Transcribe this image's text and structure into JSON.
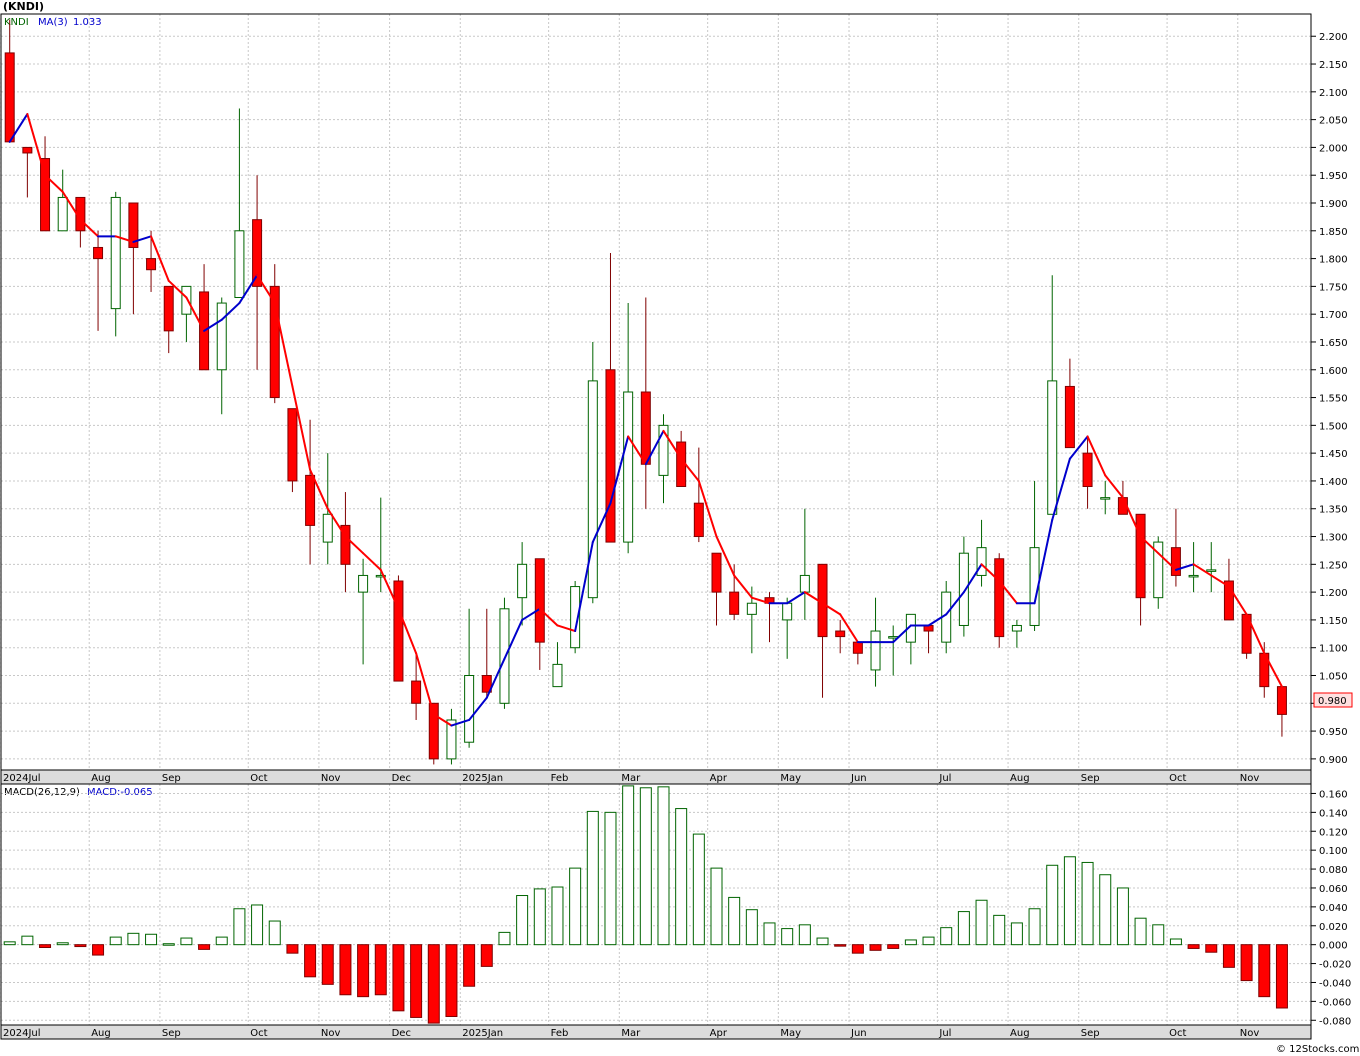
{
  "title": "(KNDI)",
  "price_legend": {
    "symbol": "KNDI",
    "ma_label": "MA(3)",
    "ma_value": "1.033"
  },
  "macd_legend": {
    "label": "MACD(26,12,9)",
    "value_label": "MACD:-0.065"
  },
  "last_price_label": "0.980",
  "watermark": "© 12Stocks.com",
  "colors": {
    "up": "#006400",
    "down": "#ff0000",
    "ma_up": "#0000cc",
    "ma_down": "#ff0000",
    "grid": "#c8c8c8",
    "axis_bar": "#dcdcdc"
  },
  "chart_data": [
    {
      "type": "candlestick",
      "title": "(KNDI)",
      "ylim": [
        0.88,
        2.24
      ],
      "yticks": [
        "2.200",
        "2.150",
        "2.100",
        "2.050",
        "2.000",
        "1.950",
        "1.900",
        "1.850",
        "1.800",
        "1.750",
        "1.700",
        "1.650",
        "1.600",
        "1.550",
        "1.500",
        "1.450",
        "1.400",
        "1.350",
        "1.300",
        "1.250",
        "1.200",
        "1.150",
        "1.100",
        "1.050",
        "1.000",
        "0.950",
        "0.900"
      ],
      "x_labels": [
        "2024Jul",
        "Aug",
        "Sep",
        "Oct",
        "Nov",
        "Dec",
        "2025Jan",
        "Feb",
        "Mar",
        "Apr",
        "May",
        "Jun",
        "Jul",
        "Aug",
        "Sep",
        "Oct",
        "Nov"
      ],
      "x_label_week": [
        0,
        5,
        9,
        14,
        18,
        22,
        26,
        31,
        35,
        40,
        44,
        48,
        53,
        57,
        61,
        66,
        70
      ],
      "ohlc": [
        [
          2.17,
          2.23,
          2.01,
          2.01
        ],
        [
          2.0,
          2.0,
          1.91,
          1.99
        ],
        [
          1.98,
          2.02,
          1.85,
          1.85
        ],
        [
          1.85,
          1.96,
          1.85,
          1.91
        ],
        [
          1.91,
          1.91,
          1.82,
          1.85
        ],
        [
          1.82,
          1.85,
          1.67,
          1.8
        ],
        [
          1.71,
          1.92,
          1.66,
          1.91
        ],
        [
          1.9,
          1.9,
          1.7,
          1.82
        ],
        [
          1.8,
          1.85,
          1.74,
          1.78
        ],
        [
          1.75,
          1.75,
          1.63,
          1.67
        ],
        [
          1.7,
          1.75,
          1.65,
          1.75
        ],
        [
          1.74,
          1.79,
          1.6,
          1.6
        ],
        [
          1.6,
          1.73,
          1.52,
          1.72
        ],
        [
          1.73,
          2.07,
          1.73,
          1.85
        ],
        [
          1.87,
          1.95,
          1.6,
          1.75
        ],
        [
          1.75,
          1.79,
          1.54,
          1.55
        ],
        [
          1.53,
          1.53,
          1.38,
          1.4
        ],
        [
          1.41,
          1.51,
          1.25,
          1.32
        ],
        [
          1.29,
          1.45,
          1.25,
          1.34
        ],
        [
          1.32,
          1.38,
          1.2,
          1.25
        ],
        [
          1.2,
          1.26,
          1.07,
          1.23
        ],
        [
          1.23,
          1.37,
          1.2,
          1.23
        ],
        [
          1.22,
          1.23,
          1.04,
          1.04
        ],
        [
          1.04,
          1.09,
          0.97,
          1.0
        ],
        [
          1.0,
          1.0,
          0.89,
          0.9
        ],
        [
          0.9,
          0.99,
          0.89,
          0.97
        ],
        [
          0.93,
          1.17,
          0.92,
          1.05
        ],
        [
          1.05,
          1.17,
          1.01,
          1.02
        ],
        [
          1.0,
          1.19,
          0.99,
          1.17
        ],
        [
          1.19,
          1.29,
          1.14,
          1.25
        ],
        [
          1.26,
          1.26,
          1.06,
          1.11
        ],
        [
          1.03,
          1.11,
          1.03,
          1.07
        ],
        [
          1.1,
          1.22,
          1.09,
          1.21
        ],
        [
          1.19,
          1.65,
          1.18,
          1.58
        ],
        [
          1.6,
          1.81,
          1.29,
          1.29
        ],
        [
          1.29,
          1.72,
          1.27,
          1.56
        ],
        [
          1.56,
          1.73,
          1.35,
          1.43
        ],
        [
          1.41,
          1.52,
          1.36,
          1.5
        ],
        [
          1.47,
          1.49,
          1.39,
          1.39
        ],
        [
          1.36,
          1.46,
          1.29,
          1.3
        ],
        [
          1.27,
          1.27,
          1.14,
          1.2
        ],
        [
          1.2,
          1.25,
          1.15,
          1.16
        ],
        [
          1.16,
          1.21,
          1.09,
          1.18
        ],
        [
          1.19,
          1.2,
          1.11,
          1.18
        ],
        [
          1.15,
          1.19,
          1.08,
          1.18
        ],
        [
          1.2,
          1.35,
          1.15,
          1.23
        ],
        [
          1.25,
          1.25,
          1.01,
          1.12
        ],
        [
          1.13,
          1.15,
          1.09,
          1.12
        ],
        [
          1.11,
          1.11,
          1.07,
          1.09
        ],
        [
          1.06,
          1.19,
          1.03,
          1.13
        ],
        [
          1.12,
          1.14,
          1.05,
          1.12
        ],
        [
          1.11,
          1.16,
          1.07,
          1.16
        ],
        [
          1.14,
          1.14,
          1.09,
          1.13
        ],
        [
          1.11,
          1.22,
          1.09,
          1.2
        ],
        [
          1.14,
          1.3,
          1.12,
          1.27
        ],
        [
          1.23,
          1.33,
          1.21,
          1.28
        ],
        [
          1.26,
          1.27,
          1.1,
          1.12
        ],
        [
          1.13,
          1.15,
          1.1,
          1.14
        ],
        [
          1.14,
          1.4,
          1.13,
          1.28
        ],
        [
          1.34,
          1.77,
          1.34,
          1.58
        ],
        [
          1.57,
          1.62,
          1.46,
          1.46
        ],
        [
          1.45,
          1.48,
          1.35,
          1.39
        ],
        [
          1.37,
          1.4,
          1.34,
          1.37
        ],
        [
          1.37,
          1.4,
          1.34,
          1.34
        ],
        [
          1.34,
          1.34,
          1.14,
          1.19
        ],
        [
          1.19,
          1.3,
          1.17,
          1.29
        ],
        [
          1.28,
          1.35,
          1.21,
          1.23
        ],
        [
          1.23,
          1.29,
          1.2,
          1.23
        ],
        [
          1.24,
          1.29,
          1.2,
          1.24
        ],
        [
          1.22,
          1.26,
          1.15,
          1.15
        ],
        [
          1.16,
          1.16,
          1.08,
          1.09
        ],
        [
          1.09,
          1.11,
          1.01,
          1.03
        ],
        [
          1.03,
          1.03,
          0.94,
          0.98
        ]
      ],
      "ma3": [
        2.01,
        2.06,
        1.95,
        1.92,
        1.87,
        1.84,
        1.84,
        1.83,
        1.84,
        1.76,
        1.73,
        1.67,
        1.69,
        1.72,
        1.77,
        1.72,
        1.57,
        1.42,
        1.35,
        1.3,
        1.27,
        1.24,
        1.17,
        1.09,
        0.98,
        0.96,
        0.97,
        1.01,
        1.08,
        1.15,
        1.17,
        1.14,
        1.13,
        1.29,
        1.36,
        1.48,
        1.43,
        1.49,
        1.44,
        1.4,
        1.3,
        1.23,
        1.19,
        1.18,
        1.18,
        1.2,
        1.18,
        1.16,
        1.11,
        1.11,
        1.11,
        1.14,
        1.14,
        1.16,
        1.2,
        1.25,
        1.22,
        1.18,
        1.18,
        1.33,
        1.44,
        1.48,
        1.41,
        1.37,
        1.3,
        1.27,
        1.24,
        1.25,
        1.23,
        1.21,
        1.16,
        1.09,
        1.03
      ]
    },
    {
      "type": "bar",
      "title": "MACD(26,12,9)",
      "ylim": [
        -0.085,
        0.17
      ],
      "yticks": [
        "0.160",
        "0.140",
        "0.120",
        "0.100",
        "0.080",
        "0.060",
        "0.040",
        "0.020",
        "0.000",
        "-0.020",
        "-0.040",
        "-0.060",
        "-0.080"
      ],
      "values": [
        0.003,
        0.009,
        -0.003,
        0.002,
        -0.002,
        -0.011,
        0.008,
        0.012,
        0.011,
        0.001,
        0.007,
        -0.005,
        0.008,
        0.038,
        0.042,
        0.025,
        -0.009,
        -0.034,
        -0.042,
        -0.053,
        -0.055,
        -0.053,
        -0.07,
        -0.077,
        -0.083,
        -0.076,
        -0.044,
        -0.023,
        0.013,
        0.052,
        0.059,
        0.061,
        0.081,
        0.141,
        0.14,
        0.168,
        0.166,
        0.167,
        0.144,
        0.117,
        0.081,
        0.05,
        0.037,
        0.023,
        0.017,
        0.021,
        0.007,
        -0.001,
        -0.009,
        -0.006,
        -0.004,
        0.005,
        0.008,
        0.018,
        0.035,
        0.047,
        0.031,
        0.023,
        0.038,
        0.084,
        0.093,
        0.087,
        0.074,
        0.06,
        0.028,
        0.021,
        0.006,
        -0.004,
        -0.008,
        -0.024,
        -0.038,
        -0.055,
        -0.067
      ]
    }
  ]
}
